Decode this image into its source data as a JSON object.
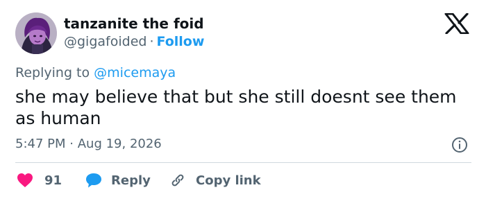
{
  "tweet": {
    "author_name": "tanzanite the foid",
    "handle": "@gigafoided",
    "separator": "·",
    "follow_label": "Follow",
    "replying_prefix": "Replying to",
    "replying_to": "@micemaya",
    "text": "she may believe that but she still doesnt see them as human",
    "time": "5:47 PM",
    "date_separator": "·",
    "date": "Aug 19, 2026"
  },
  "actions": {
    "like_count": "91",
    "reply_label": "Reply",
    "copy_link_label": "Copy link"
  },
  "icons": {
    "brand": "x-logo-icon",
    "info": "info-icon",
    "like": "heart-icon",
    "reply": "speech-bubble-icon",
    "copy": "link-icon"
  },
  "colors": {
    "text_primary": "#0f1419",
    "text_secondary": "#536471",
    "link_blue": "#1d9bf0",
    "heart_pink": "#f91880",
    "divider": "#cfd9de"
  }
}
